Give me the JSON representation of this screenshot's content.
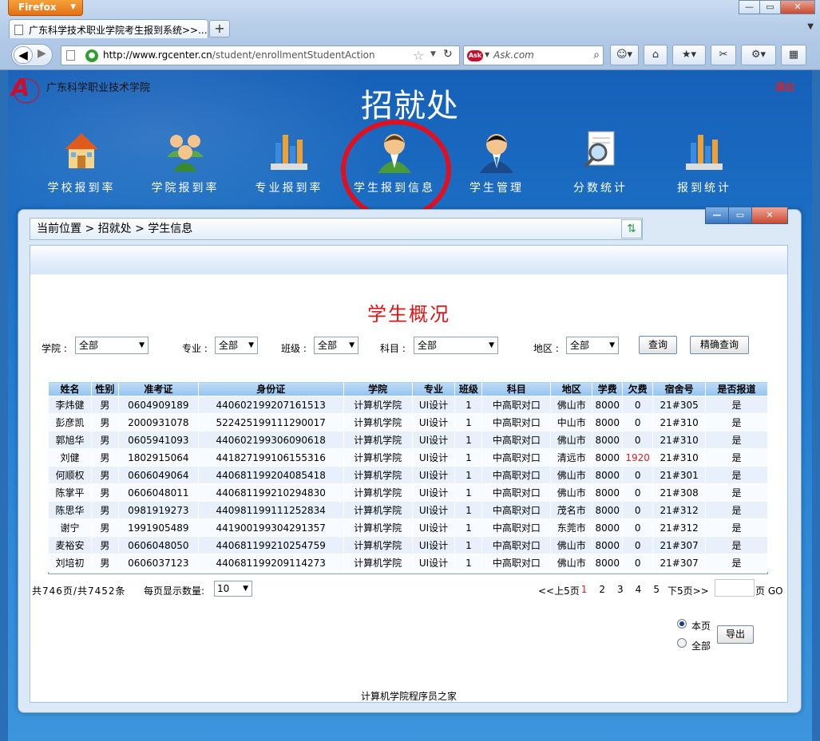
{
  "browser": {
    "app_button": "Firefox",
    "tab_title": "广东科学技术职业学院考生报到系统>>...",
    "new_tab": "+",
    "url_host": "http://www.rgcenter.cn",
    "url_path": "/student/enrollmentStudentAction",
    "search_engine": "Ask",
    "search_placeholder": "Ask.com"
  },
  "header": {
    "school_name": "广东科学职业技术学院",
    "department": "招就处",
    "logout": "退出",
    "brand_color": "#c8102e"
  },
  "nav": [
    {
      "label": "学校报到率",
      "icon": "school-house-icon"
    },
    {
      "label": "学院报到率",
      "icon": "people-group-icon"
    },
    {
      "label": "专业报到率",
      "icon": "bar-chart-icon"
    },
    {
      "label": "学生报到信息",
      "icon": "student-avatar-icon",
      "highlighted": true
    },
    {
      "label": "学生管理",
      "icon": "student-manager-icon"
    },
    {
      "label": "分数统计",
      "icon": "magnifier-document-icon"
    },
    {
      "label": "报到统计",
      "icon": "bar-chart-icon"
    }
  ],
  "breadcrumb": "当前位置 > 招就处 > 学生信息",
  "content": {
    "title": "学生概况",
    "title_color": "#e31414"
  },
  "filters": {
    "college_label": "学院 :",
    "college_value": "全部",
    "major_label": "专业 :",
    "major_value": "全部",
    "class_label": "班级 :",
    "class_value": "全部",
    "subject_label": "科目 :",
    "subject_value": "全部",
    "region_label": "地区 :",
    "region_value": "全部",
    "query_button": "查询",
    "exact_query_button": "精确查询"
  },
  "table": {
    "columns": [
      "姓名",
      "性别",
      "准考证",
      "身份证",
      "学院",
      "专业",
      "班级",
      "科目",
      "地区",
      "学费",
      "欠费",
      "宿舍号",
      "是否报道"
    ],
    "rows": [
      [
        "李炜健",
        "男",
        "0604909189",
        "440602199207161513",
        "计算机学院",
        "UI设计",
        "1",
        "中高职对口",
        "佛山市",
        "8000",
        "0",
        "21#305",
        "是"
      ],
      [
        "彭彦凯",
        "男",
        "2000931078",
        "522425199111290017",
        "计算机学院",
        "UI设计",
        "1",
        "中高职对口",
        "中山市",
        "8000",
        "0",
        "21#310",
        "是"
      ],
      [
        "郭旭华",
        "男",
        "0605941093",
        "440602199306090618",
        "计算机学院",
        "UI设计",
        "1",
        "中高职对口",
        "佛山市",
        "8000",
        "0",
        "21#310",
        "是"
      ],
      [
        "刘健",
        "男",
        "1802915064",
        "441827199106155316",
        "计算机学院",
        "UI设计",
        "1",
        "中高职对口",
        "清远市",
        "8000",
        "1920",
        "21#310",
        "是"
      ],
      [
        "何顺权",
        "男",
        "0606049064",
        "440681199204085418",
        "计算机学院",
        "UI设计",
        "1",
        "中高职对口",
        "佛山市",
        "8000",
        "0",
        "21#301",
        "是"
      ],
      [
        "陈掌平",
        "男",
        "0606048011",
        "440681199210294830",
        "计算机学院",
        "UI设计",
        "1",
        "中高职对口",
        "佛山市",
        "8000",
        "0",
        "21#308",
        "是"
      ],
      [
        "陈思华",
        "男",
        "0981919273",
        "440981199111252834",
        "计算机学院",
        "UI设计",
        "1",
        "中高职对口",
        "茂名市",
        "8000",
        "0",
        "21#312",
        "是"
      ],
      [
        "谢宁",
        "男",
        "1991905489",
        "441900199304291357",
        "计算机学院",
        "UI设计",
        "1",
        "中高职对口",
        "东莞市",
        "8000",
        "0",
        "21#312",
        "是"
      ],
      [
        "麦裕安",
        "男",
        "0606048050",
        "440681199210254759",
        "计算机学院",
        "UI设计",
        "1",
        "中高职对口",
        "佛山市",
        "8000",
        "0",
        "21#307",
        "是"
      ],
      [
        "刘培初",
        "男",
        "0606037123",
        "440681199209114273",
        "计算机学院",
        "UI设计",
        "1",
        "中高职对口",
        "佛山市",
        "8000",
        "0",
        "21#307",
        "是"
      ]
    ]
  },
  "pagination": {
    "summary": "共746页/共7452条",
    "per_page_label": "每页显示数量:",
    "per_page_value": "10",
    "prev_label": "<<上5页",
    "pages": [
      "1",
      "2",
      "3",
      "4",
      "5"
    ],
    "current_page": "1",
    "next_label": "下5页>>",
    "page_unit": "页",
    "go": "GO"
  },
  "export": {
    "this_page": "本页",
    "all": "全部",
    "export_button": "导出"
  },
  "footer": "计算机学院程序员之家"
}
